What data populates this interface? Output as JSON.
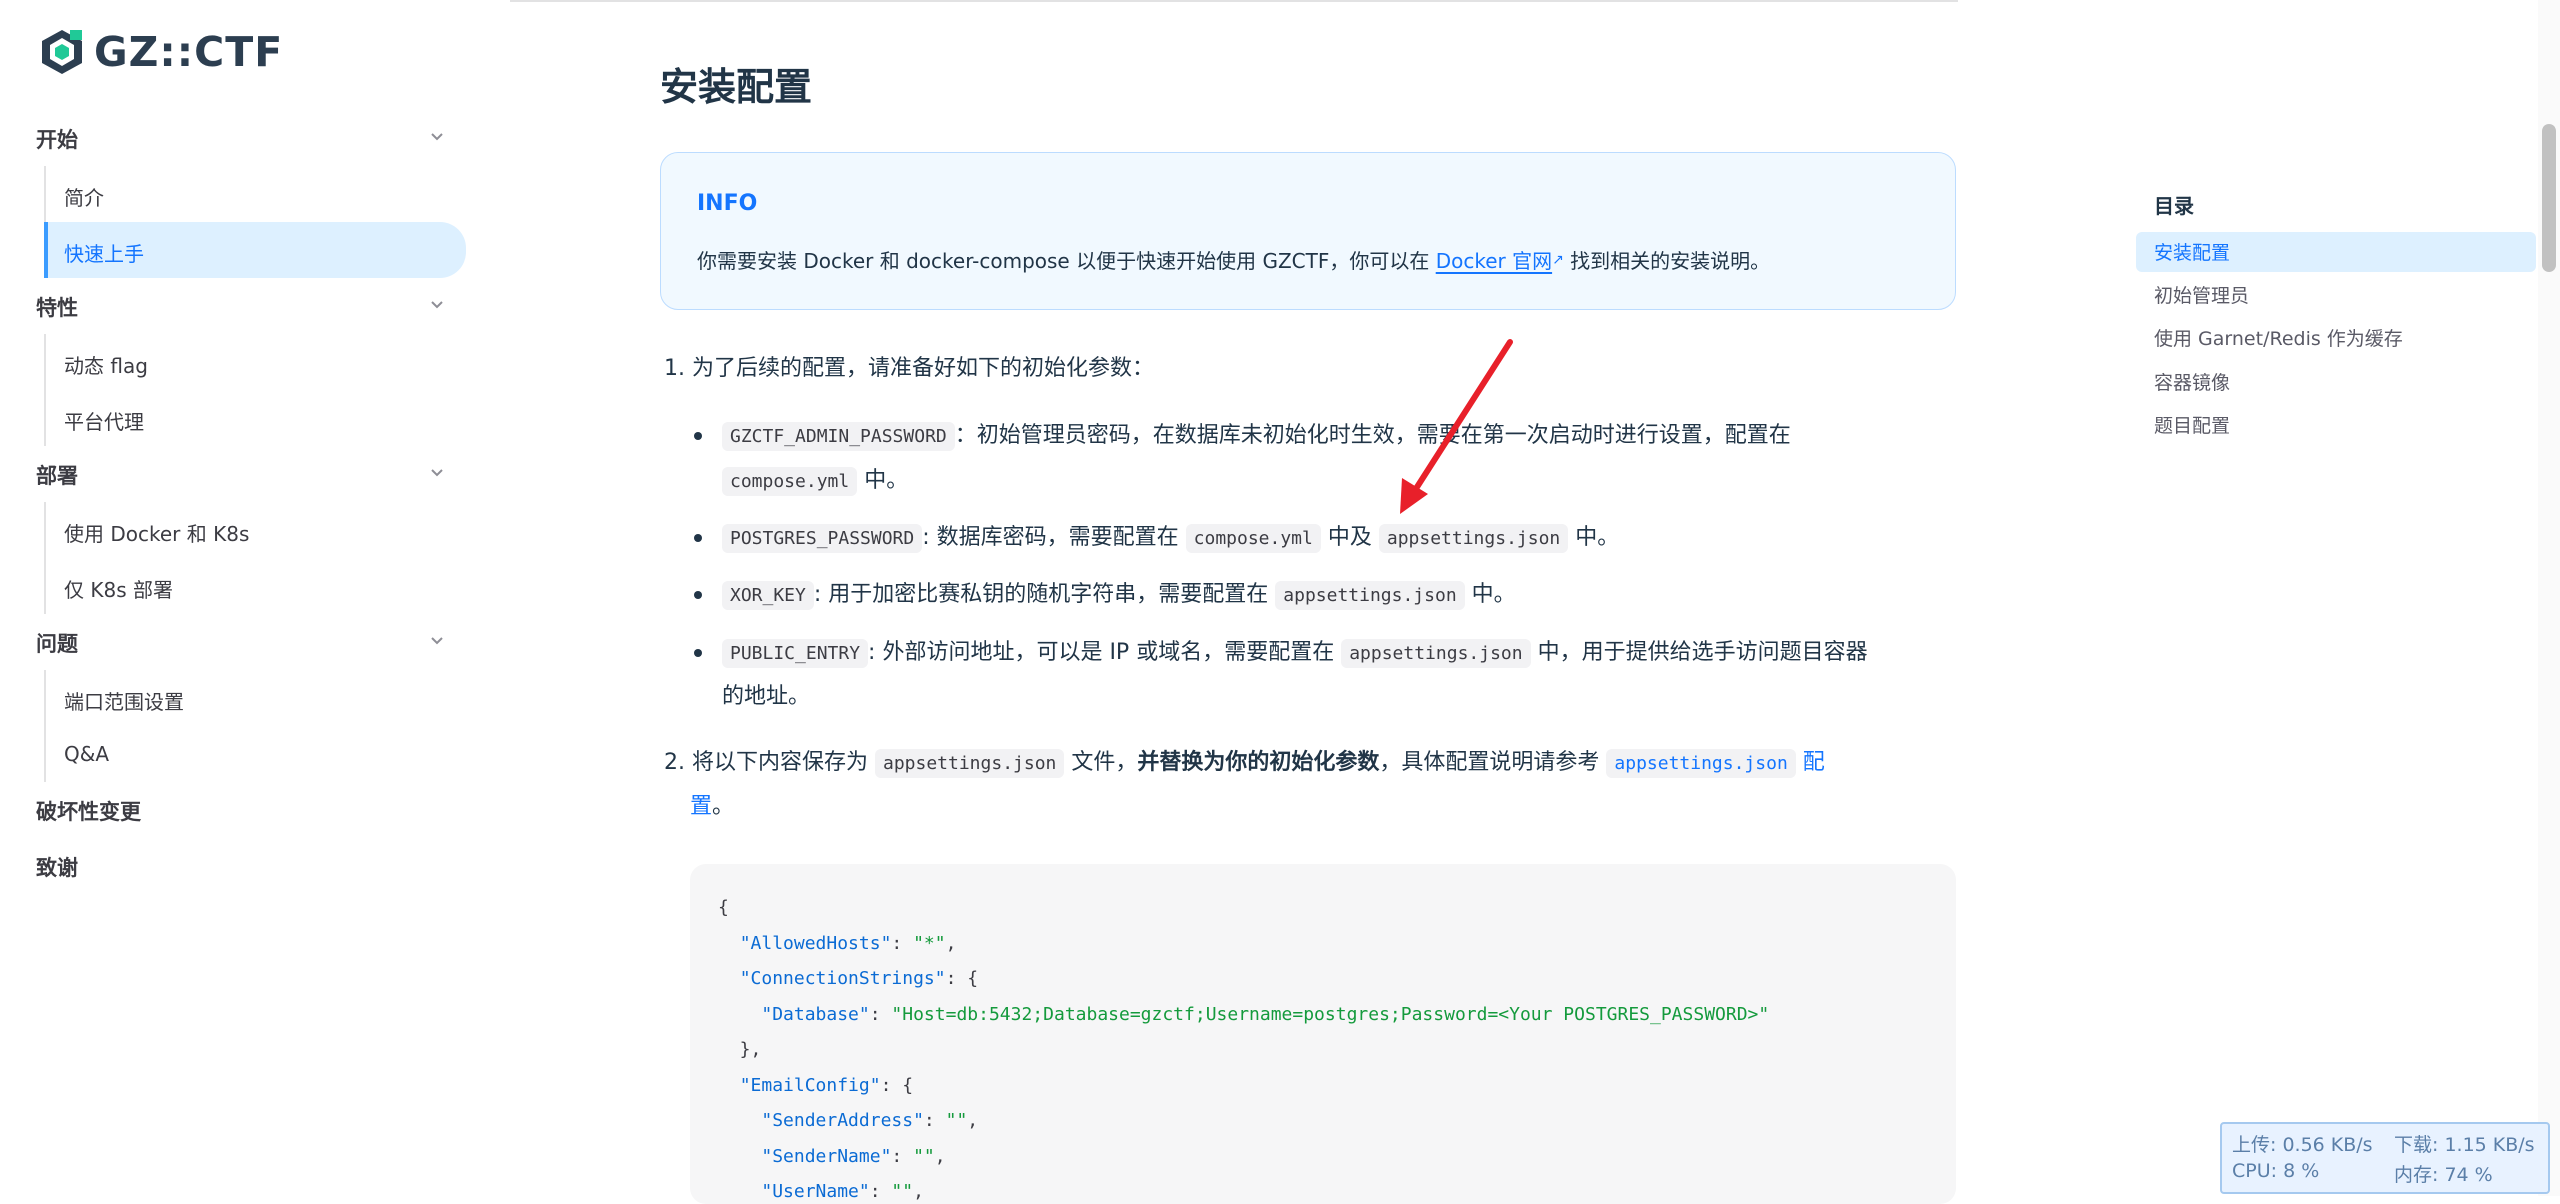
{
  "logo": {
    "text": "GZ::CTF"
  },
  "sidebar": {
    "sections": [
      {
        "title": "开始",
        "items": [
          {
            "label": "简介",
            "active": false
          },
          {
            "label": "快速上手",
            "active": true
          }
        ]
      },
      {
        "title": "特性",
        "items": [
          {
            "label": "动态 flag",
            "active": false
          },
          {
            "label": "平台代理",
            "active": false
          }
        ]
      },
      {
        "title": "部署",
        "items": [
          {
            "label": "使用 Docker 和 K8s",
            "active": false
          },
          {
            "label": "仅 K8s 部署",
            "active": false
          }
        ]
      },
      {
        "title": "问题",
        "items": [
          {
            "label": "端口范围设置",
            "active": false
          },
          {
            "label": "Q&A",
            "active": false
          }
        ]
      }
    ],
    "links": [
      "破坏性变更",
      "致谢"
    ]
  },
  "main": {
    "title": "安装配置",
    "info": {
      "title": "INFO",
      "text_before": "你需要安装 Docker 和 docker-compose 以便于快速开始使用 GZCTF，你可以在 ",
      "link": "Docker 官网",
      "text_after": " 找到相关的安装说明。"
    },
    "step1": {
      "text": "1. 为了后续的配置，请准备好如下的初始化参数：",
      "b1_code": "GZCTF_ADMIN_PASSWORD",
      "b1_text": "：初始管理员密码，在数据库未初始化时生效，需要在第一次启动时进行设置，配置在",
      "b1_code2": "compose.yml",
      "b1_tail": " 中。",
      "b2_code": "POSTGRES_PASSWORD",
      "b2_text": ": 数据库密码，需要配置在 ",
      "b2_code2": "compose.yml",
      "b2_mid": " 中及 ",
      "b2_code3": "appsettings.json",
      "b2_tail": " 中。",
      "b3_code": "XOR_KEY",
      "b3_text": ": 用于加密比赛私钥的随机字符串，需要配置在 ",
      "b3_code2": "appsettings.json",
      "b3_tail": " 中。",
      "b4_code": "PUBLIC_ENTRY",
      "b4_text": ": 外部访问地址，可以是 IP 或域名，需要配置在 ",
      "b4_code2": "appsettings.json",
      "b4_tail": " 中，用于提供给选手访问题目容器",
      "b4_line2": "的地址。"
    },
    "step2": {
      "text_before": "2. 将以下内容保存为 ",
      "code": "appsettings.json",
      "text_mid": " 文件，",
      "bold": "并替换为你的初始化参数",
      "text_after": "，具体配置说明请参考 ",
      "link_code": "appsettings.json",
      "link_text_1": " 配",
      "link_text_2": "置",
      "tail": "。"
    },
    "code_lines": [
      "{",
      "  \"AllowedHosts\": \"*\",",
      "  \"ConnectionStrings\": {",
      "    \"Database\": \"Host=db:5432;Database=gzctf;Username=postgres;Password=<Your POSTGRES_PASSWORD>\"",
      "  },",
      "  \"EmailConfig\": {",
      "    \"SenderAddress\": \"\",",
      "    \"SenderName\": \"\",",
      "    \"UserName\": \"\","
    ]
  },
  "toc": {
    "title": "目录",
    "items": [
      "安装配置",
      "初始管理员",
      "使用 Garnet/Redis 作为缓存",
      "容器镜像",
      "题目配置"
    ]
  },
  "netmon": {
    "upload": "上传: 0.56 KB/s",
    "download": "下载: 1.15 KB/s",
    "cpu": "CPU: 8 %",
    "mem": "内存: 74 %"
  },
  "colors": {
    "accent": "#1475ff",
    "active_bg": "#ddf0ff",
    "arrow": "#e8202a"
  }
}
